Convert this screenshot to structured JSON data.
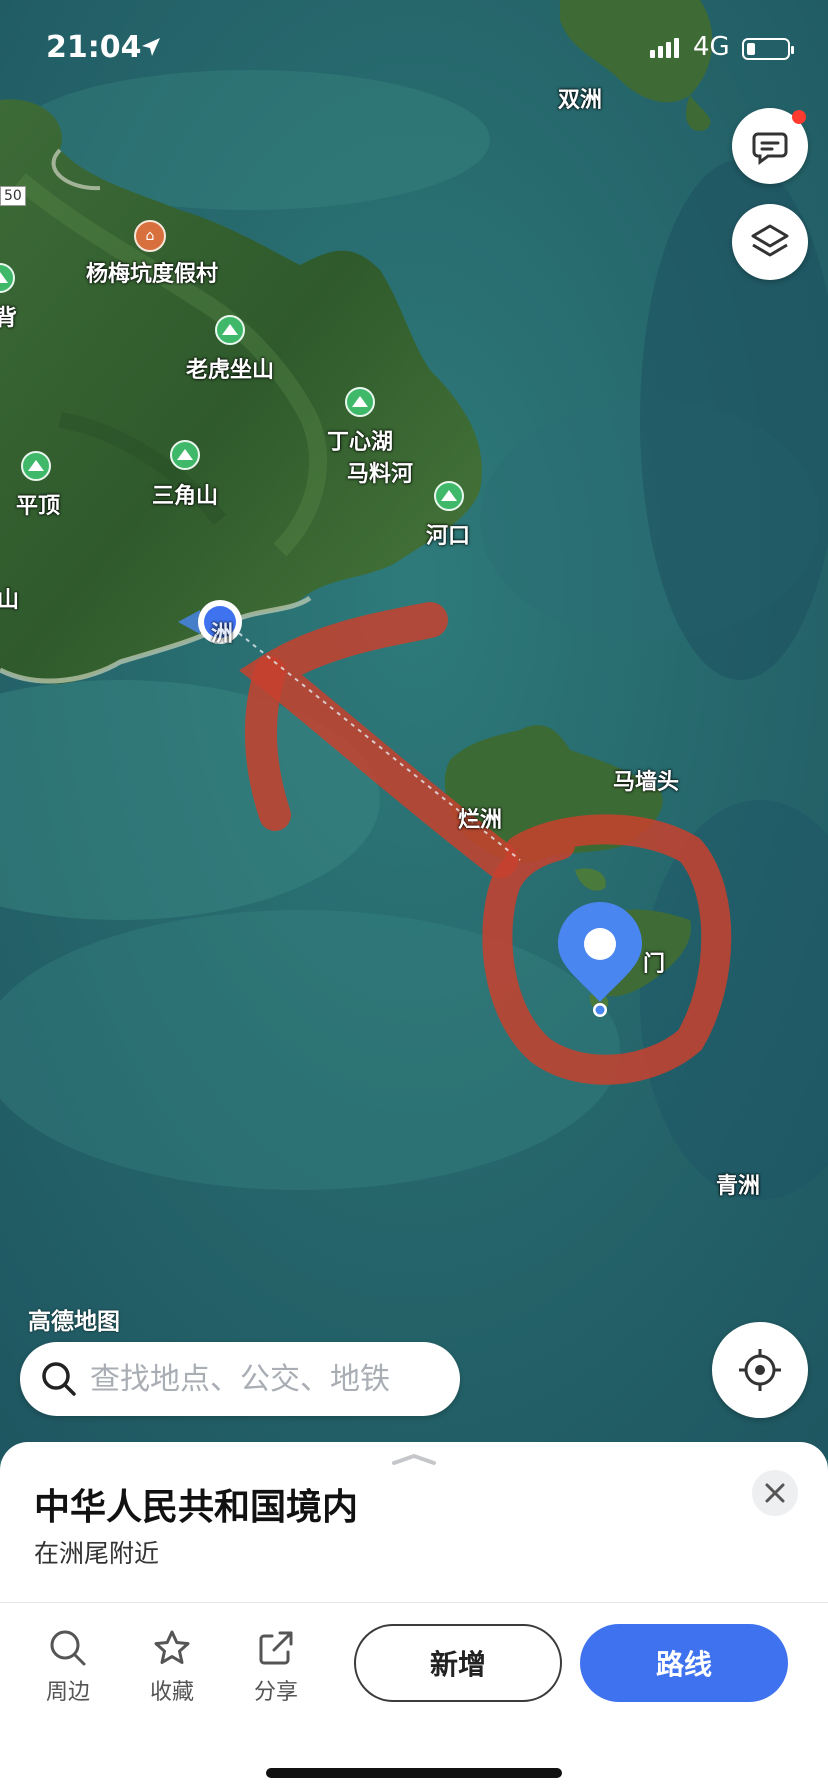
{
  "status_bar": {
    "time": "21:04",
    "network": "4G"
  },
  "map": {
    "labels": [
      {
        "id": "shuangzhou",
        "text": "双洲"
      },
      {
        "id": "yangmeikeng",
        "text": "杨梅坑度假村"
      },
      {
        "id": "laohuzuo",
        "text": "老虎坐山"
      },
      {
        "id": "dingxinhu",
        "text": "丁心湖"
      },
      {
        "id": "maliaohe",
        "text": "马料河"
      },
      {
        "id": "sanjiaoshan",
        "text": "三角山"
      },
      {
        "id": "pingding",
        "text": "平顶"
      },
      {
        "id": "hekou",
        "text": "河口"
      },
      {
        "id": "bei",
        "text": "背"
      },
      {
        "id": "shan",
        "text": "山"
      },
      {
        "id": "num50",
        "text": "50"
      },
      {
        "id": "maqiangtou",
        "text": "马墙头"
      },
      {
        "id": "lanzhou",
        "text": "烂洲"
      },
      {
        "id": "men",
        "text": "门"
      },
      {
        "id": "qingzhou",
        "text": "青洲"
      }
    ],
    "watermark": "高德地图",
    "colors": {
      "annotation": "#c8412e",
      "pin": "#4a86f0"
    }
  },
  "search": {
    "placeholder": "查找地点、公交、地铁"
  },
  "sheet": {
    "title": "中华人民共和国境内",
    "subtitle": "在洲尾附近",
    "actions": {
      "nearby": "周边",
      "favorite": "收藏",
      "share": "分享"
    },
    "add_label": "新增",
    "route_label": "路线"
  }
}
